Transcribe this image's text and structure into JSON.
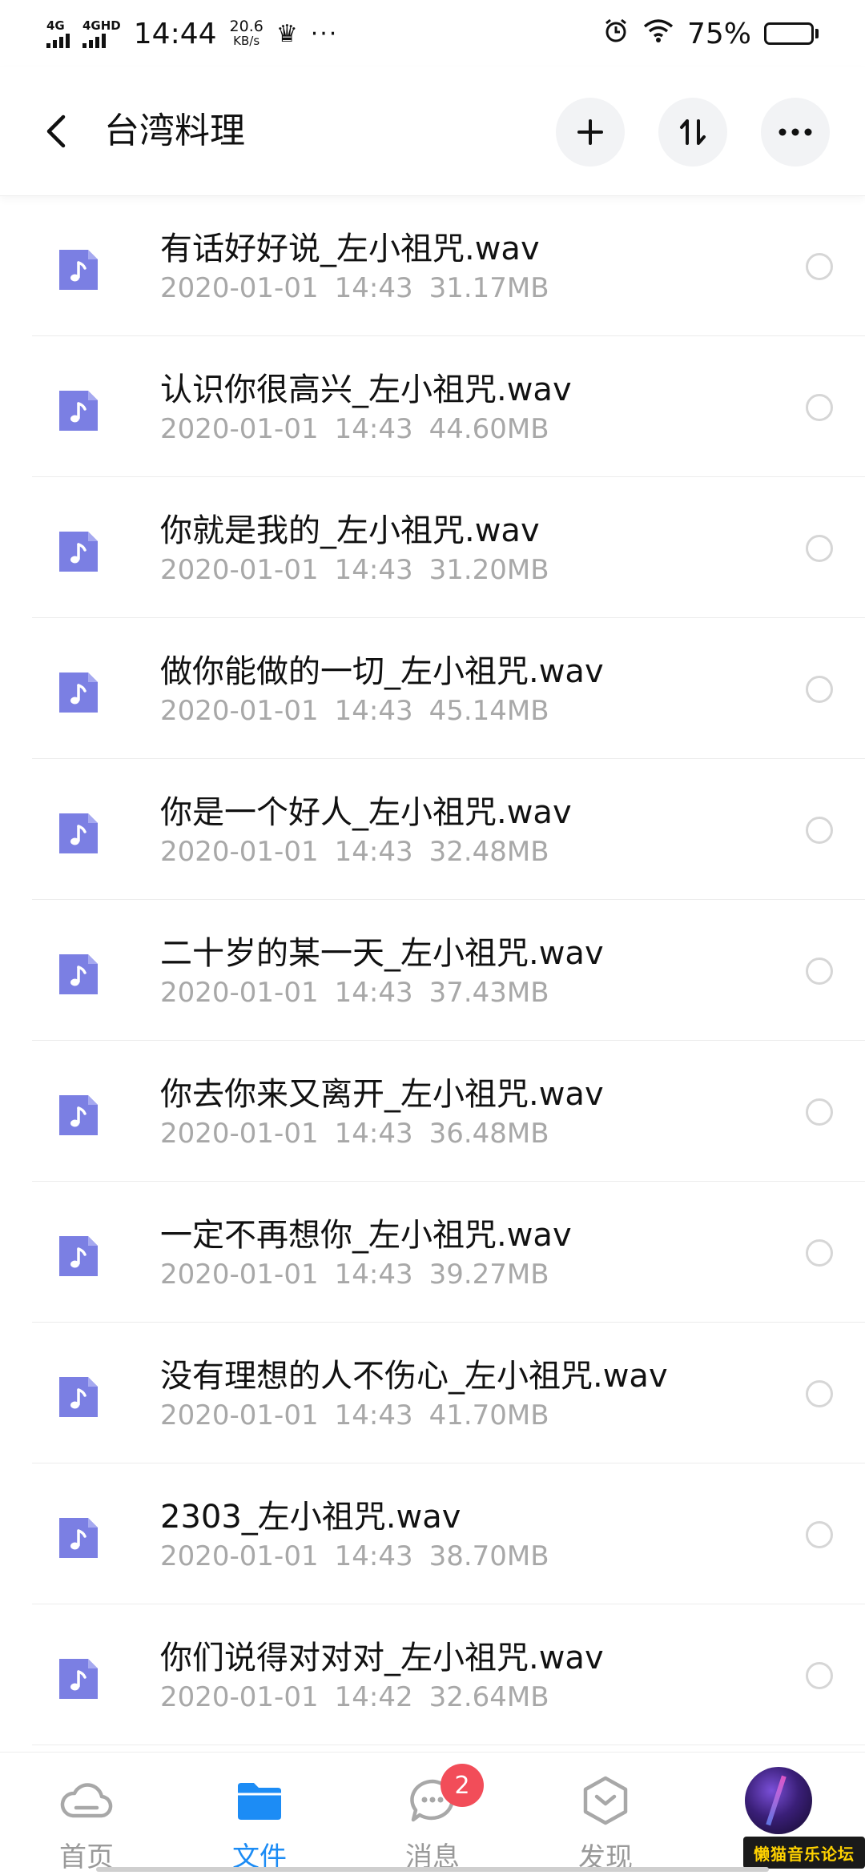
{
  "status_bar": {
    "network1": "4G",
    "network2": "4GHD",
    "time": "14:44",
    "speed_value": "20.6",
    "speed_unit": "KB/s",
    "more": "···",
    "battery": "75%",
    "battery_level": 0.75
  },
  "header": {
    "title": "台湾料理",
    "icons": [
      "back-icon",
      "add-icon",
      "sort-icon",
      "more-icon"
    ]
  },
  "files": [
    {
      "name": "有话好好说_左小祖咒.wav",
      "date": "2020-01-01",
      "time": "14:43",
      "size": "31.17MB"
    },
    {
      "name": "认识你很高兴_左小祖咒.wav",
      "date": "2020-01-01",
      "time": "14:43",
      "size": "44.60MB"
    },
    {
      "name": "你就是我的_左小祖咒.wav",
      "date": "2020-01-01",
      "time": "14:43",
      "size": "31.20MB"
    },
    {
      "name": "做你能做的一切_左小祖咒.wav",
      "date": "2020-01-01",
      "time": "14:43",
      "size": "45.14MB"
    },
    {
      "name": "你是一个好人_左小祖咒.wav",
      "date": "2020-01-01",
      "time": "14:43",
      "size": "32.48MB"
    },
    {
      "name": "二十岁的某一天_左小祖咒.wav",
      "date": "2020-01-01",
      "time": "14:43",
      "size": "37.43MB"
    },
    {
      "name": "你去你来又离开_左小祖咒.wav",
      "date": "2020-01-01",
      "time": "14:43",
      "size": "36.48MB"
    },
    {
      "name": "一定不再想你_左小祖咒.wav",
      "date": "2020-01-01",
      "time": "14:43",
      "size": "39.27MB"
    },
    {
      "name": "没有理想的人不伤心_左小祖咒.wav",
      "date": "2020-01-01",
      "time": "14:43",
      "size": "41.70MB"
    },
    {
      "name": "2303_左小祖咒.wav",
      "date": "2020-01-01",
      "time": "14:43",
      "size": "38.70MB"
    },
    {
      "name": "你们说得对对对_左小祖咒.wav",
      "date": "2020-01-01",
      "time": "14:42",
      "size": "32.64MB"
    }
  ],
  "tabbar": {
    "home": "首页",
    "files": "文件",
    "messages": "消息",
    "messages_badge": "2",
    "discover": "发现"
  },
  "watermark": "懒猫音乐论坛",
  "colors": {
    "accent": "#1c8cf5",
    "file_icon": "#7b7fe3",
    "badge": "#f24d59"
  }
}
